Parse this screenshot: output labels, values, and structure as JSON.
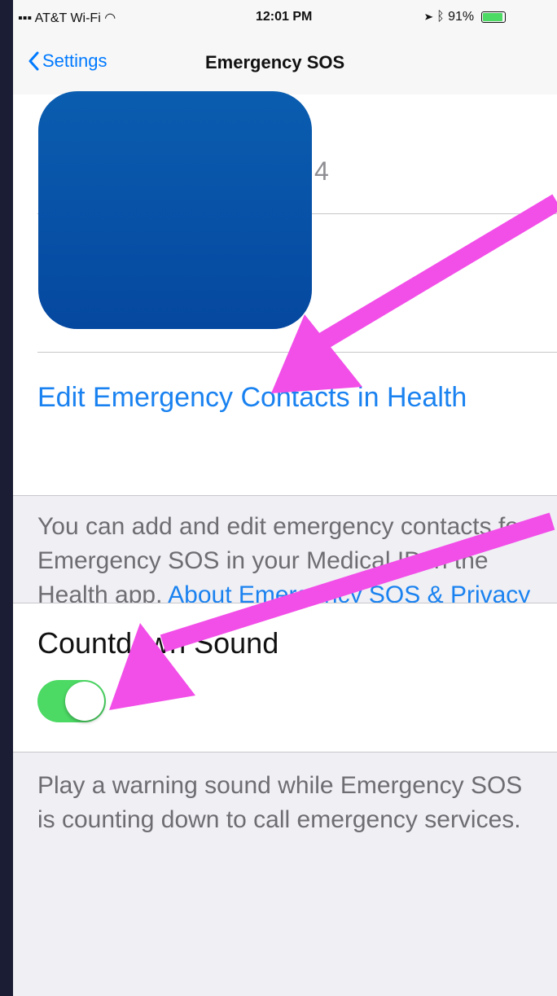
{
  "status_bar": {
    "carrier": "AT&T Wi-Fi",
    "time": "12:01 PM",
    "battery_text": "91%",
    "battery_level": 0.91
  },
  "nav": {
    "back_label": "Settings",
    "title": "Emergency SOS"
  },
  "contacts": {
    "partial_row_text": "4",
    "edit_link": "Edit Emergency Contacts in Health"
  },
  "contacts_footer": {
    "text": "You can add and edit emergency contacts for Emergency SOS in your Medical ID in the Health app. ",
    "link": "About Emergency SOS & Privacy"
  },
  "countdown": {
    "label": "Countdown Sound",
    "enabled": true
  },
  "countdown_footer": {
    "text": "Play a warning sound while Emergency SOS is counting down to call emergency services."
  },
  "colors": {
    "accent": "#007aff",
    "toggle_on": "#4cd964",
    "annotation_arrow": "#f24ee8",
    "icon_blue": "#0548a0"
  }
}
